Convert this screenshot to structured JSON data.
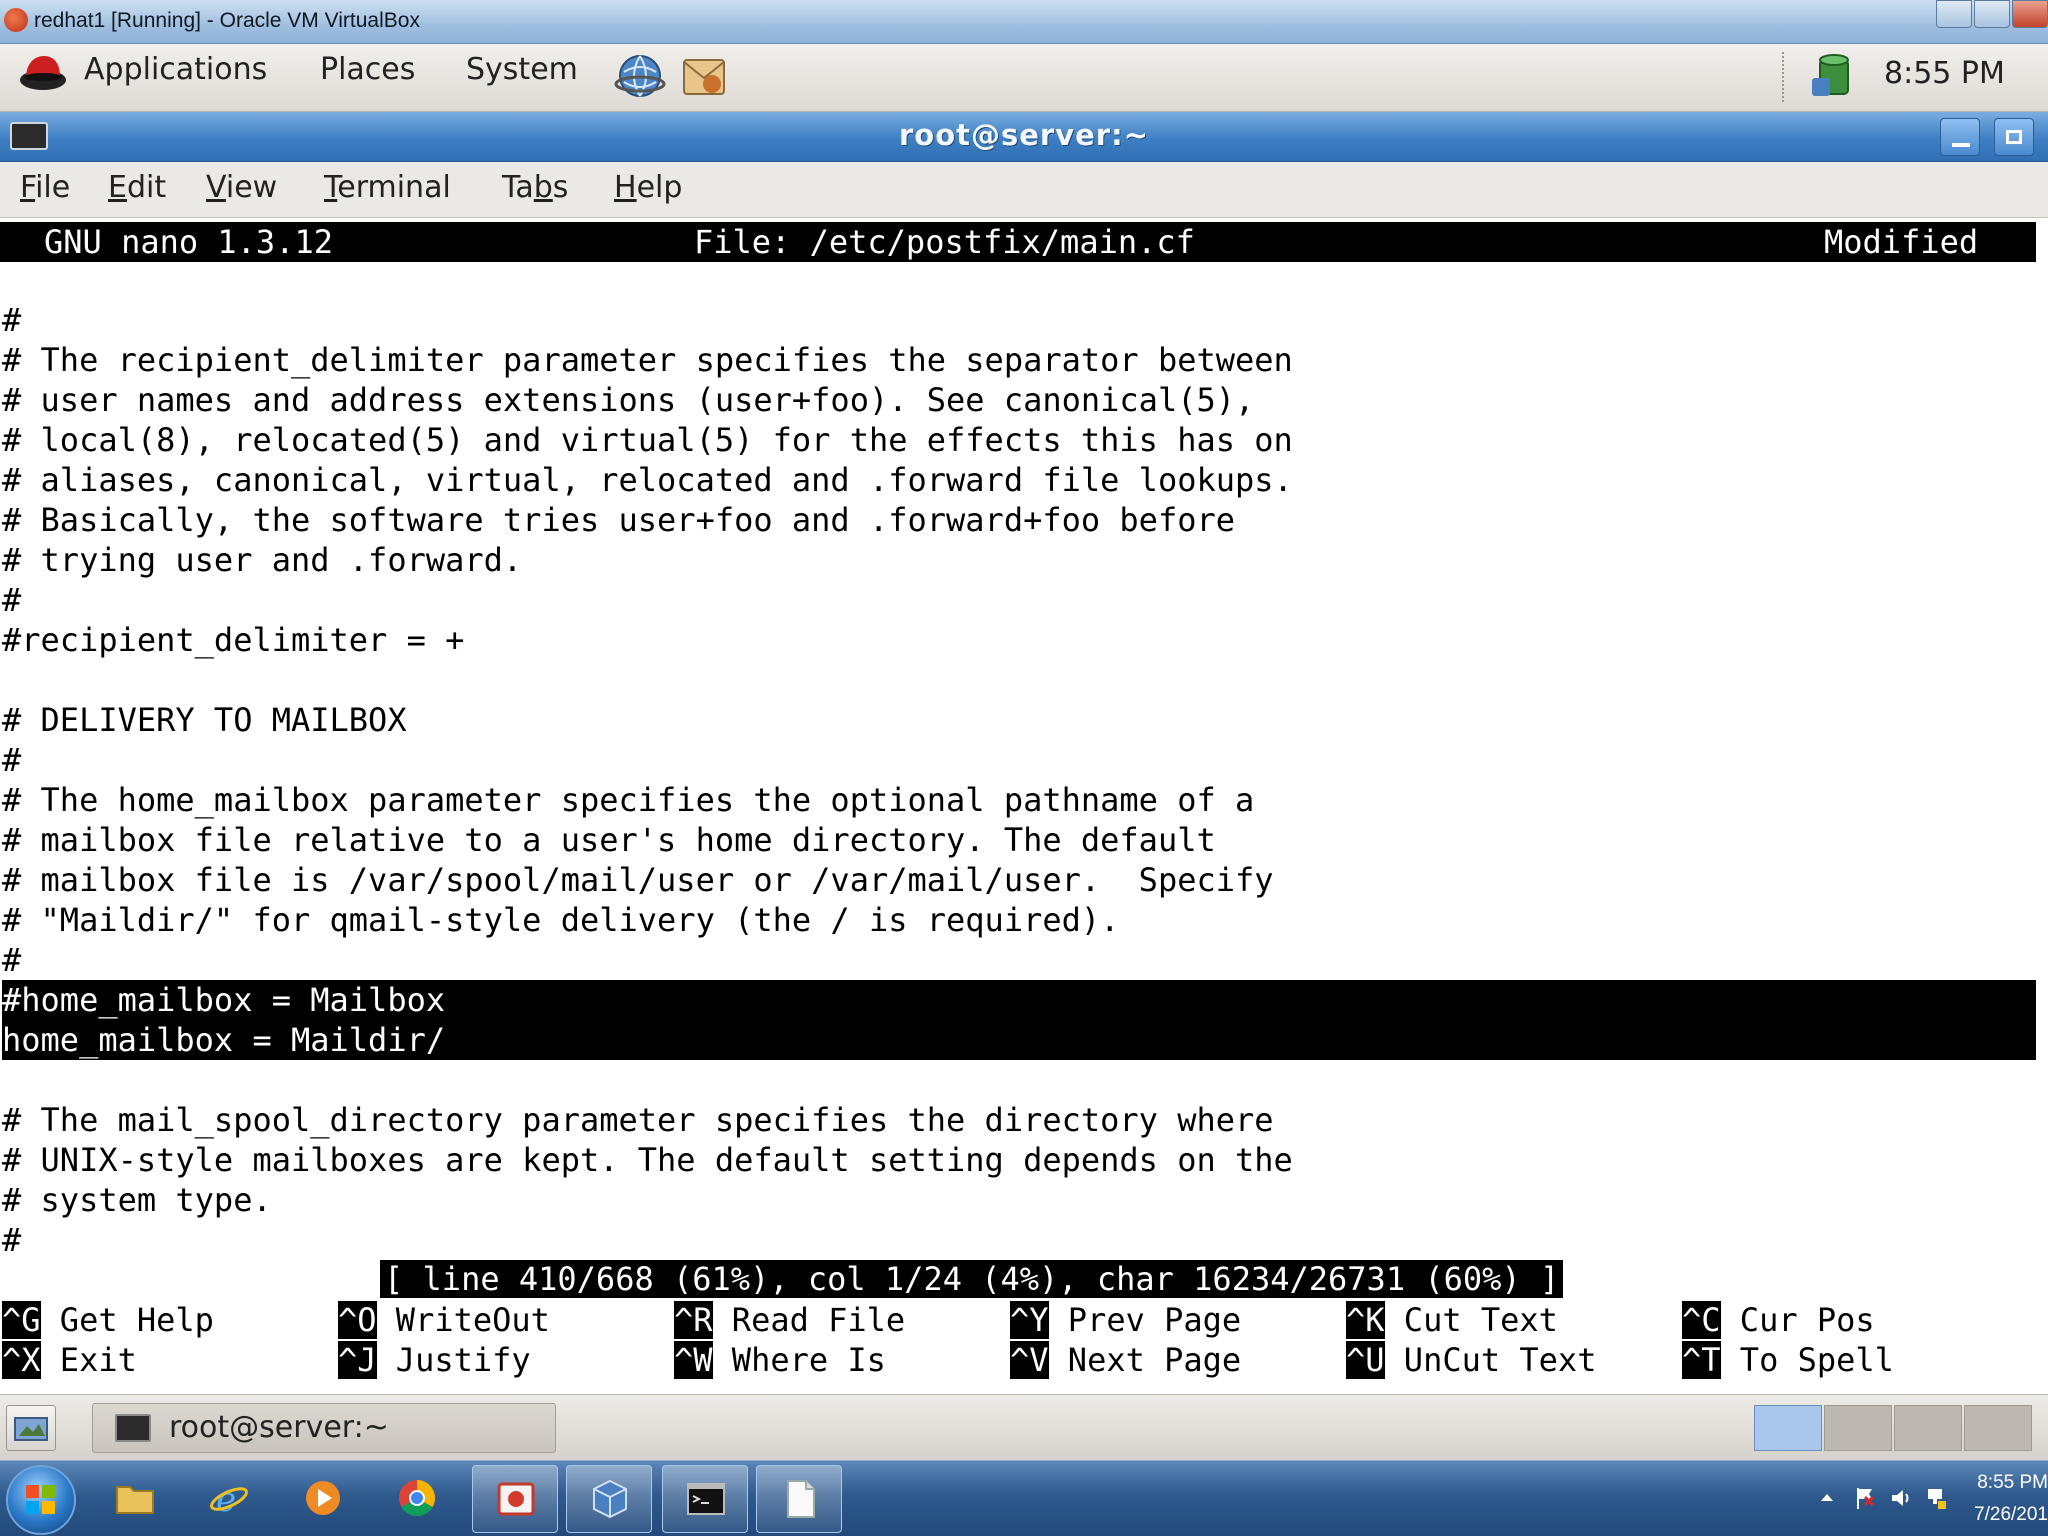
{
  "host_window": {
    "title": "redhat1 [Running] - Oracle VM VirtualBox"
  },
  "gnome_panel": {
    "menus": [
      "Applications",
      "Places",
      "System"
    ],
    "clock": "8:55 PM"
  },
  "terminal_window": {
    "title": "root@server:~",
    "menu": [
      "File",
      "Edit",
      "View",
      "Terminal",
      "Tabs",
      "Help"
    ],
    "menu_mnemonics": [
      "F",
      "E",
      "V",
      "T",
      "b",
      "H"
    ]
  },
  "nano": {
    "version": "GNU nano 1.3.12",
    "file": "File: /etc/postfix/main.cf",
    "state": "Modified",
    "lines": [
      "#",
      "# The recipient_delimiter parameter specifies the separator between",
      "# user names and address extensions (user+foo). See canonical(5),",
      "# local(8), relocated(5) and virtual(5) for the effects this has on",
      "# aliases, canonical, virtual, relocated and .forward file lookups.",
      "# Basically, the software tries user+foo and .forward+foo before",
      "# trying user and .forward.",
      "#",
      "#recipient_delimiter = +",
      "",
      "# DELIVERY TO MAILBOX",
      "#",
      "# The home_mailbox parameter specifies the optional pathname of a",
      "# mailbox file relative to a user's home directory. The default",
      "# mailbox file is /var/spool/mail/user or /var/mail/user.  Specify",
      "# \"Maildir/\" for qmail-style delivery (the / is required).",
      "#",
      "#home_mailbox = Mailbox",
      "home_mailbox = Maildir/",
      "",
      "# The mail_spool_directory parameter specifies the directory where",
      "# UNIX-style mailboxes are kept. The default setting depends on the",
      "# system type.",
      "#"
    ],
    "status": "[ line 410/668 (61%), col 1/24 (4%), char 16234/26731 (60%) ]",
    "shortcuts": [
      {
        "key": "^G",
        "label": "Get Help"
      },
      {
        "key": "^O",
        "label": "WriteOut"
      },
      {
        "key": "^R",
        "label": "Read File"
      },
      {
        "key": "^Y",
        "label": "Prev Page"
      },
      {
        "key": "^K",
        "label": "Cut Text"
      },
      {
        "key": "^C",
        "label": "Cur Pos"
      },
      {
        "key": "^X",
        "label": "Exit"
      },
      {
        "key": "^J",
        "label": "Justify"
      },
      {
        "key": "^W",
        "label": "Where Is"
      },
      {
        "key": "^V",
        "label": "Next Page"
      },
      {
        "key": "^U",
        "label": "UnCut Text"
      },
      {
        "key": "^T",
        "label": "To Spell"
      }
    ]
  },
  "gnome_bottom_panel": {
    "task_label": "root@server:~"
  },
  "windows_taskbar": {
    "time": "8:55 PM",
    "date": "7/26/201"
  },
  "colors": {
    "terminal_bg": "#ffffff",
    "terminal_fg": "#000000",
    "highlight_bg": "#000000",
    "title_blue": "#3e7fc4"
  }
}
